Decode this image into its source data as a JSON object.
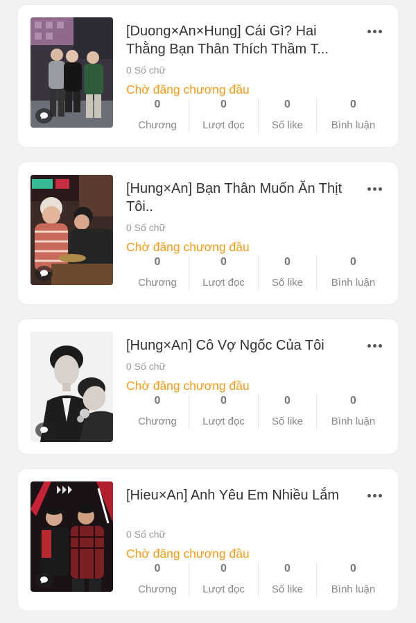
{
  "stat_labels": {
    "chapters": "Chương",
    "reads": "Lượt đọc",
    "likes": "Số like",
    "comments": "Bình luận"
  },
  "stories": [
    {
      "title": "[Duong×An×Hung] Cái Gì? Hai Thằng Bạn Thân Thích Thầm T...",
      "words": "0 Số chữ",
      "status": "Chờ đăng chương đầu",
      "chapters": "0",
      "reads": "0",
      "likes": "0",
      "comments": "0"
    },
    {
      "title": "[Hung×An] Bạn Thân Muốn Ăn Thịt Tôi..",
      "words": "0 Số chữ",
      "status": "Chờ đăng chương đầu",
      "chapters": "0",
      "reads": "0",
      "likes": "0",
      "comments": "0"
    },
    {
      "title": "[Hung×An] Cô Vợ Ngốc Của Tôi",
      "words": "0 Số chữ",
      "status": "Chờ đăng chương đầu",
      "chapters": "0",
      "reads": "0",
      "likes": "0",
      "comments": "0"
    },
    {
      "title": "[Hieu×An] Anh Yêu Em Nhiều Lắm",
      "words": "0 Số chữ",
      "status": "Chờ đăng chương đầu",
      "chapters": "0",
      "reads": "0",
      "likes": "0",
      "comments": "0"
    }
  ],
  "colors": {
    "status": "#f39b1c",
    "background": "#f2f2f4",
    "card": "#ffffff"
  }
}
